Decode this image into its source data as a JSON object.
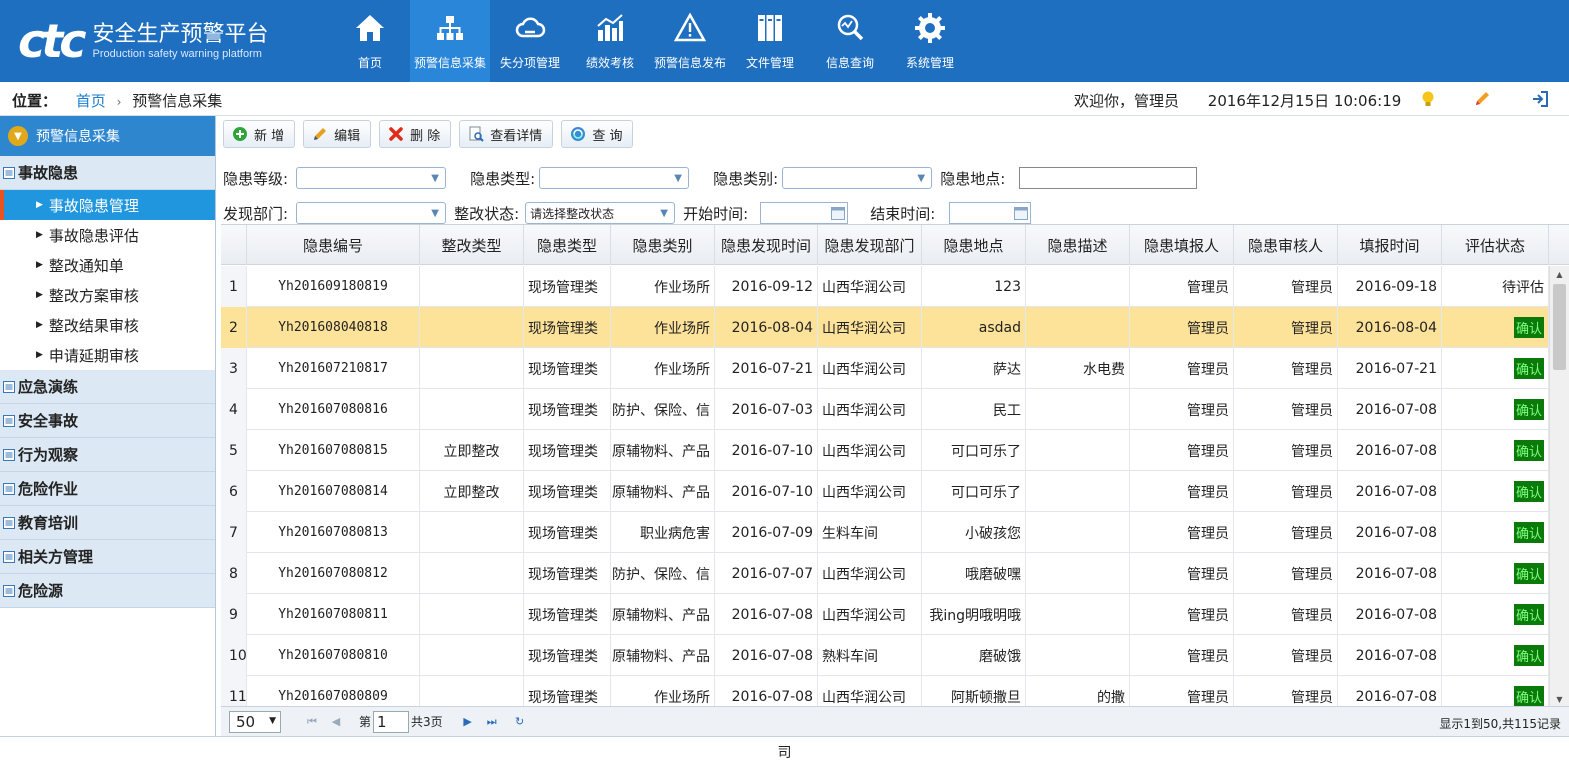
{
  "header": {
    "logo_mark": "ctc",
    "logo_title": "安全生产预警平台",
    "logo_subtitle": "Production safety warning platform",
    "nav": [
      {
        "label": "首页",
        "icon": "home-icon"
      },
      {
        "label": "预警信息采集",
        "icon": "org-chart-icon",
        "active": true
      },
      {
        "label": "失分项管理",
        "icon": "cloud-icon"
      },
      {
        "label": "绩效考核",
        "icon": "bar-chart-icon"
      },
      {
        "label": "预警信息发布",
        "icon": "warning-icon"
      },
      {
        "label": "文件管理",
        "icon": "binders-icon"
      },
      {
        "label": "信息查询",
        "icon": "magnifier-icon"
      },
      {
        "label": "系统管理",
        "icon": "gear-icon"
      }
    ]
  },
  "location": {
    "label": "位置：",
    "home": "首页",
    "current": "预警信息采集",
    "welcome": "欢迎你，管理员",
    "datetime": "2016年12月15日 10:06:19"
  },
  "sidebar": {
    "title": "预警信息采集",
    "groups": [
      {
        "label": "事故隐患",
        "items": [
          "事故隐患管理",
          "事故隐患评估",
          "整改通知单",
          "整改方案审核",
          "整改结果审核",
          "申请延期审核"
        ]
      },
      {
        "label": "应急演练"
      },
      {
        "label": "安全事故"
      },
      {
        "label": "行为观察"
      },
      {
        "label": "危险作业"
      },
      {
        "label": "教育培训"
      },
      {
        "label": "相关方管理"
      },
      {
        "label": "危险源"
      }
    ]
  },
  "toolbar": {
    "add": "新 增",
    "edit": "编辑",
    "delete": "删 除",
    "detail": "查看详情",
    "query": "查 询"
  },
  "filters": {
    "level_label": "隐患等级:",
    "type_label": "隐患类型:",
    "category_label": "隐患类别:",
    "location_label": "隐患地点:",
    "dept_label": "发现部门:",
    "status_label": "整改状态:",
    "status_value": "请选择整改状态",
    "start_label": "开始时间:",
    "end_label": "结束时间:"
  },
  "table": {
    "columns": [
      "",
      "隐患编号",
      "整改类型",
      "隐患类型",
      "隐患类别",
      "隐患发现时间",
      "隐患发现部门",
      "隐患地点",
      "隐患描述",
      "隐患填报人",
      "隐患审核人",
      "填报时间",
      "评估状态"
    ],
    "rows": [
      [
        "1",
        "Yh201609180819",
        "",
        "现场管理类",
        "作业场所",
        "2016-09-12",
        "山西华润公司",
        "123",
        "",
        "管理员",
        "管理员",
        "2016-09-18",
        "待评估"
      ],
      [
        "2",
        "Yh201608040818",
        "",
        "现场管理类",
        "作业场所",
        "2016-08-04",
        "山西华润公司",
        "asdad",
        "",
        "管理员",
        "管理员",
        "2016-08-04",
        "确认"
      ],
      [
        "3",
        "Yh201607210817",
        "",
        "现场管理类",
        "作业场所",
        "2016-07-21",
        "山西华润公司",
        "萨达",
        "水电费",
        "管理员",
        "管理员",
        "2016-07-21",
        "确认"
      ],
      [
        "4",
        "Yh201607080816",
        "",
        "现场管理类",
        "防护、保险、信",
        "2016-07-03",
        "山西华润公司",
        "民工",
        "",
        "管理员",
        "管理员",
        "2016-07-08",
        "确认"
      ],
      [
        "5",
        "Yh201607080815",
        "立即整改",
        "现场管理类",
        "原辅物料、产品",
        "2016-07-10",
        "山西华润公司",
        "可口可乐了",
        "",
        "管理员",
        "管理员",
        "2016-07-08",
        "确认"
      ],
      [
        "6",
        "Yh201607080814",
        "立即整改",
        "现场管理类",
        "原辅物料、产品",
        "2016-07-10",
        "山西华润公司",
        "可口可乐了",
        "",
        "管理员",
        "管理员",
        "2016-07-08",
        "确认"
      ],
      [
        "7",
        "Yh201607080813",
        "",
        "现场管理类",
        "职业病危害",
        "2016-07-09",
        "生料车间",
        "小破孩您",
        "",
        "管理员",
        "管理员",
        "2016-07-08",
        "确认"
      ],
      [
        "8",
        "Yh201607080812",
        "",
        "现场管理类",
        "防护、保险、信",
        "2016-07-07",
        "山西华润公司",
        "哦磨破嘿",
        "",
        "管理员",
        "管理员",
        "2016-07-08",
        "确认"
      ],
      [
        "9",
        "Yh201607080811",
        "",
        "现场管理类",
        "原辅物料、产品",
        "2016-07-08",
        "山西华润公司",
        "我ing明哦明哦",
        "",
        "管理员",
        "管理员",
        "2016-07-08",
        "确认"
      ],
      [
        "10",
        "Yh201607080810",
        "",
        "现场管理类",
        "原辅物料、产品",
        "2016-07-08",
        "熟料车间",
        "磨破饿",
        "",
        "管理员",
        "管理员",
        "2016-07-08",
        "确认"
      ],
      [
        "11",
        "Yh201607080809",
        "",
        "现场管理类",
        "作业场所",
        "2016-07-08",
        "山西华润公司",
        "阿斯顿撒旦",
        "的撒",
        "管理员",
        "管理员",
        "2016-07-08",
        "确认"
      ]
    ],
    "selected_row": 2
  },
  "pager": {
    "page_size": "50",
    "page_prefix": "第",
    "page_value": "1",
    "page_total": "共3页",
    "info": "显示1到50,共115记录"
  },
  "footer": {
    "text": "司"
  },
  "colors": {
    "header_bg": "#1f6fc0",
    "nav_active": "#2a86d8",
    "side_active": "#1f96dd",
    "selected_row": "#fde39a",
    "confirm_badge": "#0b7a0b"
  }
}
